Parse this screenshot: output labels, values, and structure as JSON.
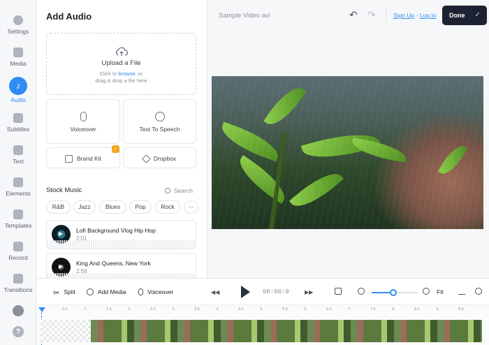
{
  "sidebar": {
    "items": [
      {
        "label": "Settings",
        "icon": "settings-icon"
      },
      {
        "label": "Media",
        "icon": "media-icon"
      },
      {
        "label": "Audio",
        "icon": "audio-icon",
        "active": true
      },
      {
        "label": "Subtitles",
        "icon": "subtitles-icon"
      },
      {
        "label": "Text",
        "icon": "text-icon"
      },
      {
        "label": "Elements",
        "icon": "elements-icon"
      },
      {
        "label": "Templates",
        "icon": "templates-icon"
      },
      {
        "label": "Record",
        "icon": "record-icon"
      },
      {
        "label": "Transitions",
        "icon": "transitions-icon"
      }
    ],
    "help_glyph": "?"
  },
  "panel": {
    "title": "Add Audio",
    "upload": {
      "title": "Upload a File",
      "line1_prefix": "Click to ",
      "line1_link": "browse",
      "line1_suffix": ", or",
      "line2": "drag & drop a file here"
    },
    "tiles": {
      "voiceover": "Voiceover",
      "tts": "Text To Speech",
      "brand_kit": "Brand Kit",
      "dropbox": "Dropbox"
    },
    "premium_glyph": "⚡",
    "stock_label": "Stock Music",
    "search_label": "Search",
    "genres": [
      "R&B",
      "Jazz",
      "Blues",
      "Pop",
      "Rock"
    ],
    "more_glyph": "···",
    "tracks": [
      {
        "name": "Lofi Background Vlog Hip Hop",
        "duration": "2:01"
      },
      {
        "name": "King And Queens, New York",
        "duration": "2:56"
      }
    ]
  },
  "topbar": {
    "doc_title": "Sample Video avi",
    "undo_glyph": "↶",
    "redo_glyph": "↷",
    "sign_up": "Sign Up",
    "separator": " - ",
    "log_in": "Log In",
    "done": "Done",
    "done_check": "✓"
  },
  "toolbar": {
    "split": "Split",
    "add_media": "Add Media",
    "voiceover": "Voiceover",
    "skip_back": "◀◀",
    "skip_fwd": "▶▶",
    "time": "00:00:0",
    "fit": "Fit",
    "zoom_level": 0.47
  },
  "timeline": {
    "ticks": [
      "0.5",
      "1",
      "1.5",
      "2",
      "2.5",
      "3",
      "3.5",
      "4",
      "4.5",
      "5",
      "5.5",
      "6",
      "6.5",
      "7",
      "7.5",
      "8",
      "8.5",
      "9",
      "9.5"
    ]
  },
  "colors": {
    "accent": "#2f8cf3",
    "done_bg": "#1d2233",
    "premium": "#f5a524"
  }
}
